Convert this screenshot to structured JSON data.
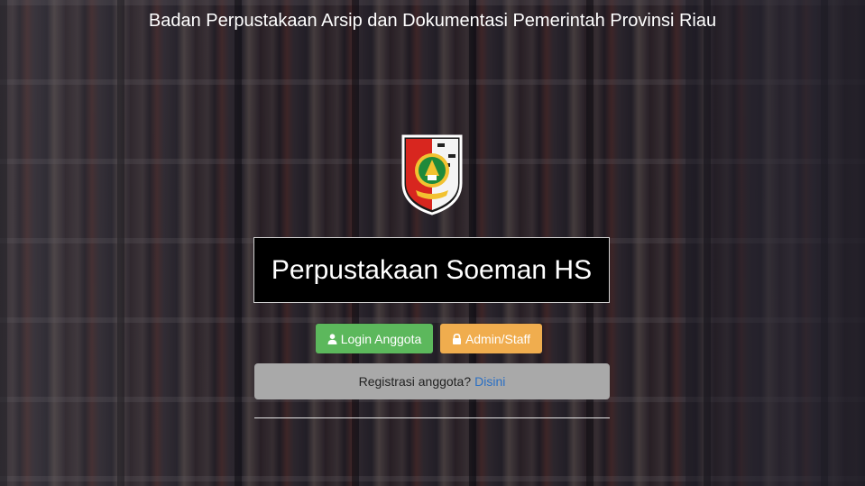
{
  "header": {
    "title": "Badan Perpustakaan Arsip dan Dokumentasi Pemerintah Provinsi Riau"
  },
  "logo": {
    "icon": "riau-province-emblem-icon"
  },
  "main": {
    "title": "Perpustakaan Soeman HS",
    "buttons": {
      "login_label": "Login Anggota",
      "login_icon": "user-icon",
      "login_color": "#5cb85c",
      "admin_label": "Admin/Staff",
      "admin_icon": "lock-icon",
      "admin_color": "#f0ad4e"
    },
    "registration": {
      "text": "Registrasi anggota?",
      "link_label": "Disini",
      "link_color": "#2a6fc4"
    }
  }
}
